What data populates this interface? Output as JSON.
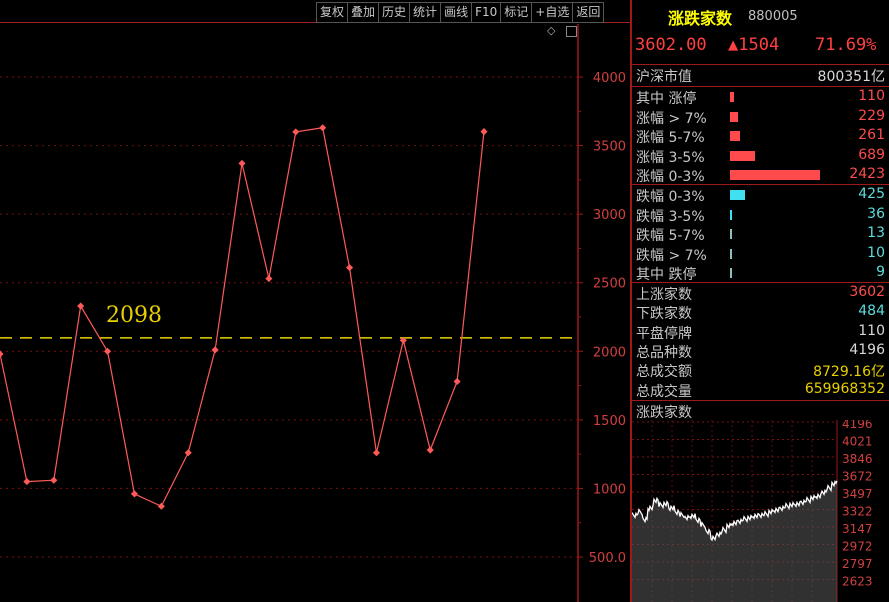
{
  "toolbar": [
    "复权",
    "叠加",
    "历史",
    "统计",
    "画线",
    "F10",
    "标记",
    "+自选",
    "返回"
  ],
  "chart_data": {
    "type": "line",
    "x": [
      0,
      1,
      2,
      3,
      4,
      5,
      6,
      7,
      8,
      9,
      10,
      11,
      12,
      13,
      14,
      15,
      16,
      17,
      18
    ],
    "values": [
      1980,
      1050,
      1060,
      2330,
      2000,
      960,
      870,
      1260,
      2010,
      3370,
      2530,
      3600,
      3630,
      2610,
      1260,
      2080,
      1280,
      1780,
      3602
    ],
    "ylim": [
      500,
      4200
    ],
    "yticks": [
      "4000",
      "3500",
      "3000",
      "2500",
      "2000",
      "1500",
      "1000",
      "500.0"
    ],
    "ytick_values": [
      4000,
      3500,
      3000,
      2500,
      2000,
      1500,
      1000,
      500
    ],
    "reference_value": 2098,
    "reference_label": "2098",
    "line_color": "#ff5a5a",
    "reference_color": "#e8d000"
  },
  "header": {
    "title": "涨跌家数",
    "code": "880005",
    "price": "3602.00",
    "change": "▲1504",
    "pct": "71.69%"
  },
  "market_cap": {
    "label": "沪深市值",
    "value": "800351亿"
  },
  "up_rows": [
    {
      "label": "其中 涨停",
      "value": "110",
      "bar": 0.03
    },
    {
      "label": "涨幅 > 7%",
      "value": "229",
      "bar": 0.06
    },
    {
      "label": "涨幅 5-7%",
      "value": "261",
      "bar": 0.07
    },
    {
      "label": "涨幅 3-5%",
      "value": "689",
      "bar": 0.18
    },
    {
      "label": "涨幅 0-3%",
      "value": "2423",
      "bar": 0.64
    }
  ],
  "down_rows": [
    {
      "label": "跌幅 0-3%",
      "value": "425",
      "bar": 0.11
    },
    {
      "label": "跌幅 3-5%",
      "value": "36",
      "bar": 0.01
    },
    {
      "label": "跌幅 5-7%",
      "value": "13",
      "bar": 0.005
    },
    {
      "label": "跌幅 > 7%",
      "value": "10",
      "bar": 0.005
    },
    {
      "label": "其中 跌停",
      "value": "9",
      "bar": 0.005
    }
  ],
  "stats": [
    {
      "label": "上涨家数",
      "value": "3602",
      "color": "up"
    },
    {
      "label": "下跌家数",
      "value": "484",
      "color": "dn"
    },
    {
      "label": "平盘停牌",
      "value": "110",
      "color": "wh"
    },
    {
      "label": "总品种数",
      "value": "4196",
      "color": "wh"
    },
    {
      "label": "总成交额",
      "value": "8729.16亿",
      "color": "yl"
    },
    {
      "label": "总成交量",
      "value": "659968352",
      "color": "yl"
    }
  ],
  "mini": {
    "title": "涨跌家数",
    "yticks": [
      "4196",
      "4021",
      "3846",
      "3672",
      "3497",
      "3322",
      "3147",
      "2972",
      "2797",
      "2623"
    ]
  },
  "colors": {
    "accent_red": "#ff4040",
    "frame": "#a01818",
    "bg": "#000000"
  }
}
